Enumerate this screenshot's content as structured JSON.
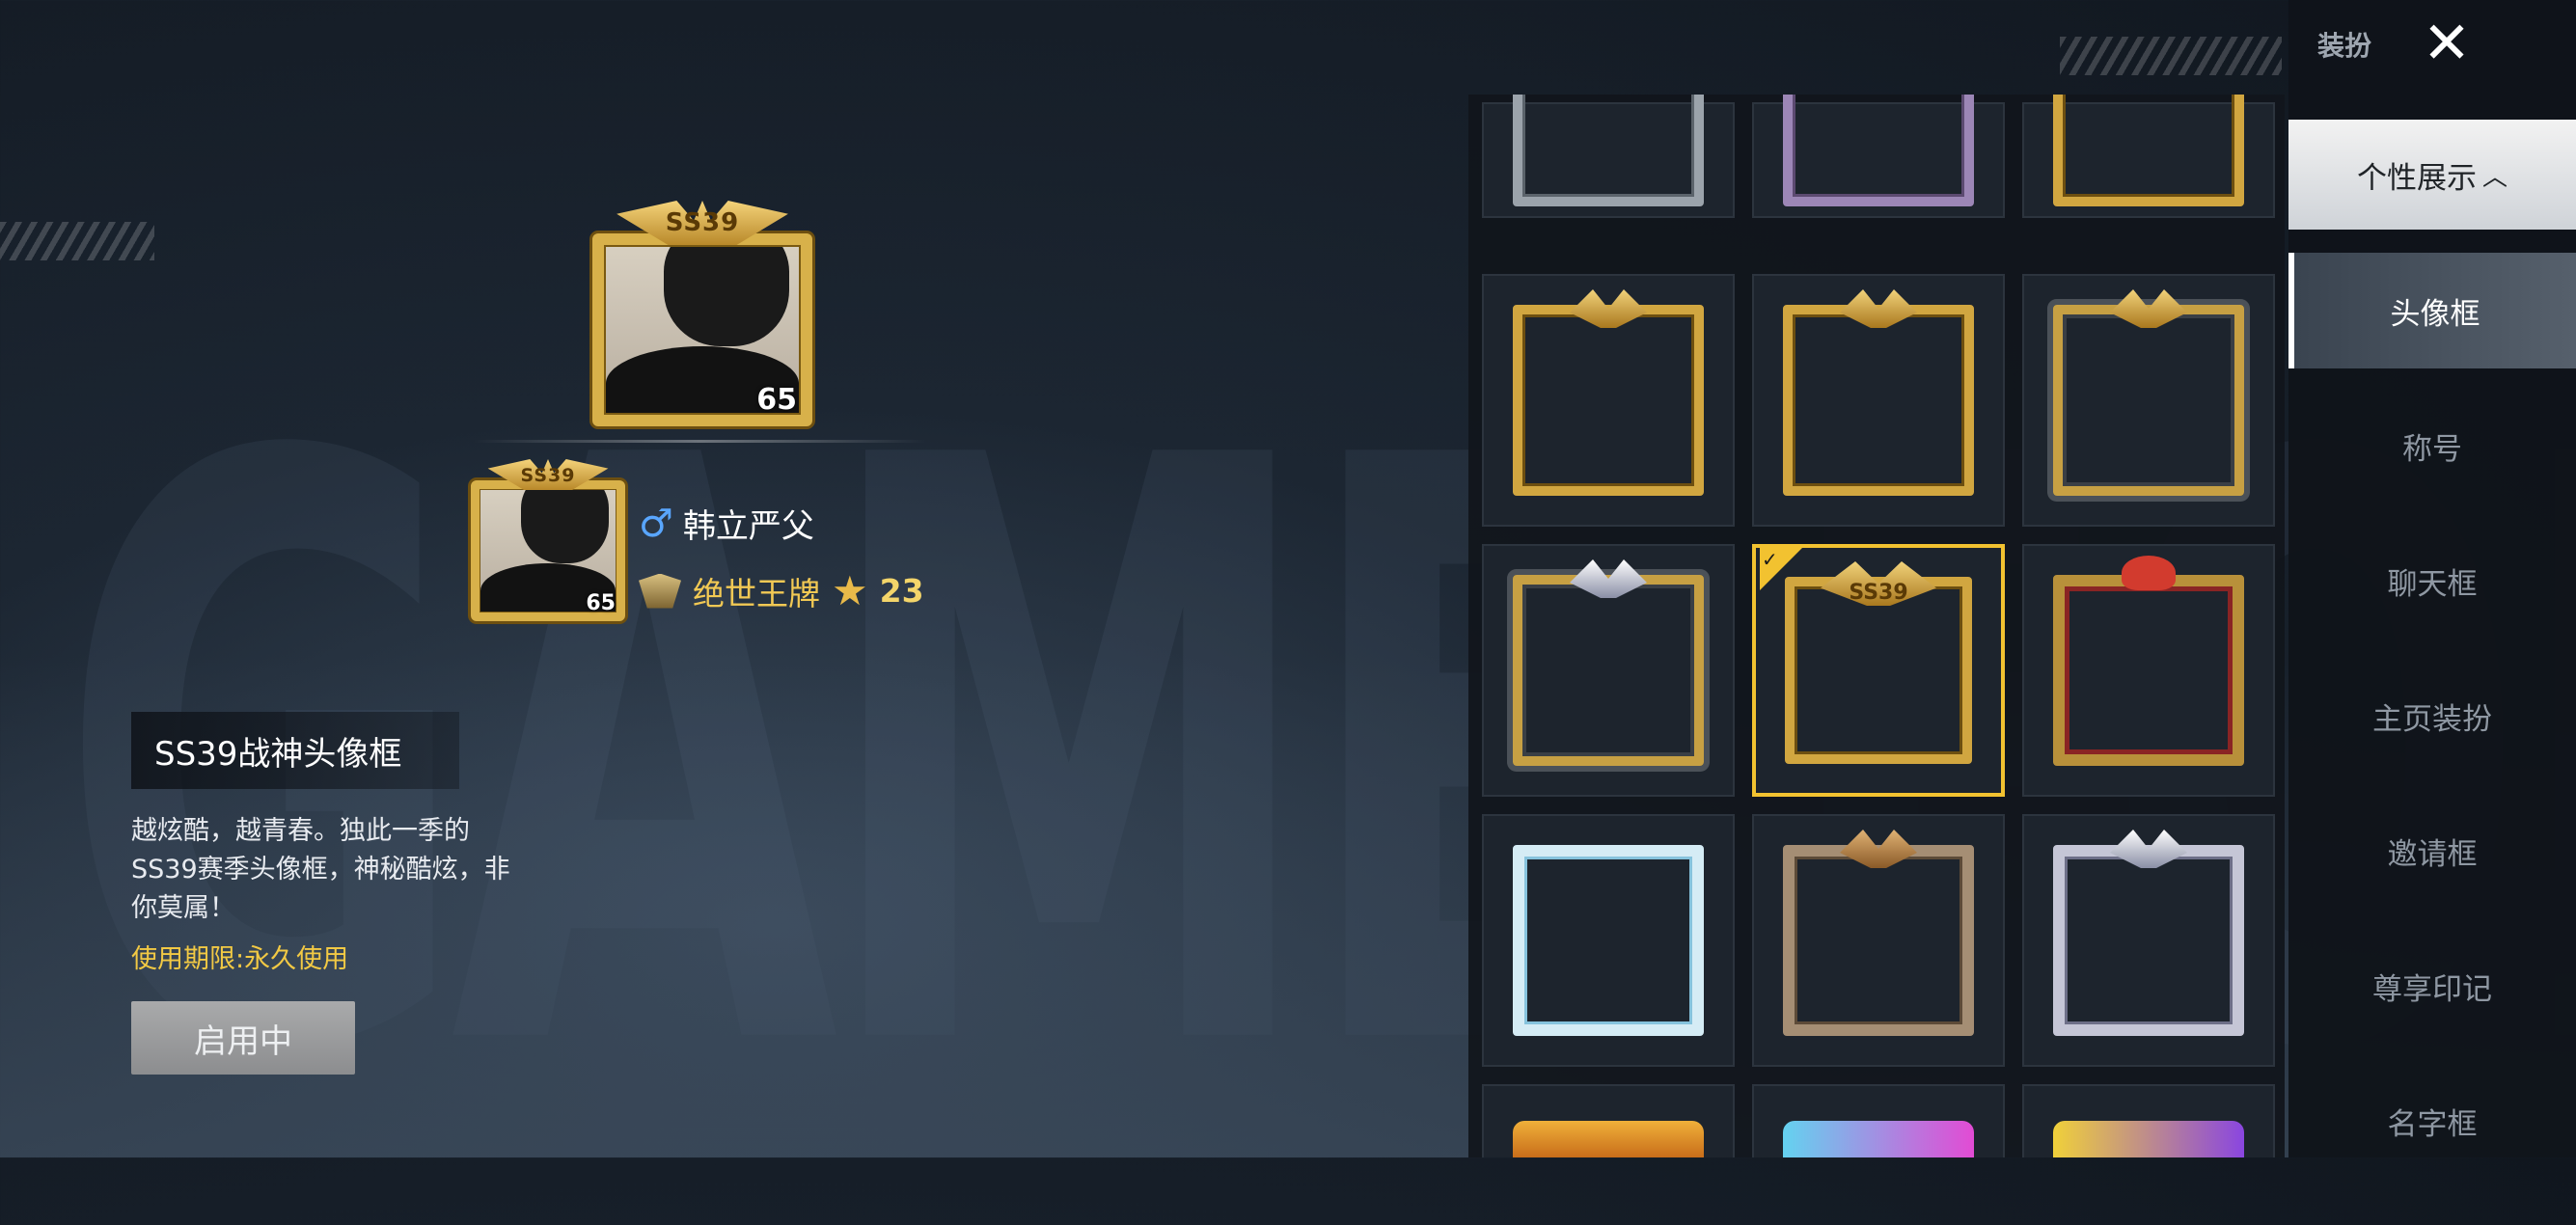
{
  "background": {
    "watermark": "GAME FOR"
  },
  "preview": {
    "large_badge": "SS39",
    "large_level": "65",
    "small_badge": "SS39",
    "small_level": "65",
    "player_name": "韩立严父",
    "rank_name": "绝世王牌",
    "star_count": "23"
  },
  "item": {
    "title": "SS39战神头像框",
    "description": "越炫酷，越青春。独此一季的SS39赛季头像框，神秘酷炫，非你莫属！",
    "expire": "使用期限:永久使用",
    "use_button": "启用中"
  },
  "grid": {
    "selected_badge": "SS39",
    "rows": [
      [
        "silver",
        "purple",
        "gold"
      ],
      [
        "gold",
        "gold",
        "darkgold"
      ],
      [
        "darkgold",
        "gold-selected",
        "christmas"
      ],
      [
        "ice",
        "bronze",
        "platinum"
      ],
      [
        "orange",
        "pink",
        "yellow"
      ]
    ]
  },
  "sidebar": {
    "title": "装扮",
    "section": "个性展示",
    "items": [
      "头像框",
      "称号",
      "聊天框",
      "主页装扮",
      "邀请框",
      "尊享印记",
      "名字框"
    ],
    "active_item": "头像框"
  },
  "colors": {
    "accent_gold": "#f2c230",
    "name_male": "#59a6ff",
    "expire_text": "#f2c944"
  },
  "icons": {
    "close": "close-icon",
    "male": "male-icon",
    "rank": "rank-icon",
    "star": "star-icon",
    "chevron": "chevron-up-icon",
    "check": "check-icon"
  }
}
